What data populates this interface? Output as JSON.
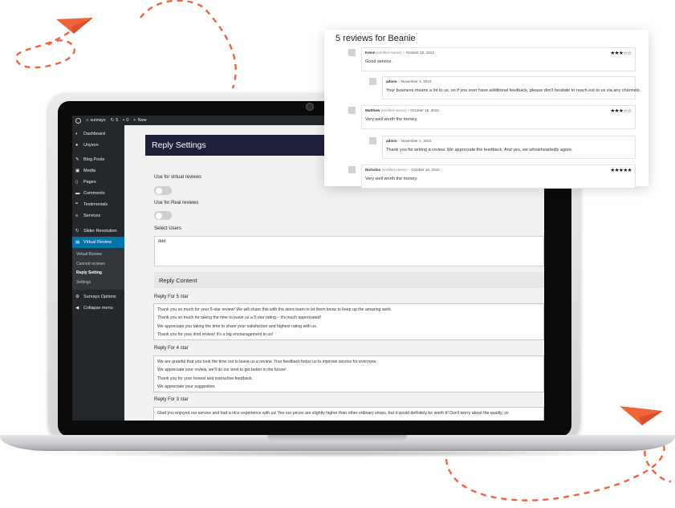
{
  "admin_bar": {
    "site_name": "sunrays",
    "updates_count": "5",
    "comments_count": "0",
    "new_label": "New"
  },
  "sidebar": {
    "items_top": [
      {
        "label": "Dashboard",
        "icon": "dashboard-icon"
      },
      {
        "label": "Unyson",
        "icon": "unyson-icon"
      }
    ],
    "items_mid": [
      {
        "label": "Blog Posts",
        "icon": "pin-icon"
      },
      {
        "label": "Media",
        "icon": "media-icon"
      },
      {
        "label": "Pages",
        "icon": "page-icon"
      },
      {
        "label": "Comments",
        "icon": "comment-icon"
      },
      {
        "label": "Testimonials",
        "icon": "quote-icon"
      },
      {
        "label": "Services",
        "icon": "list-icon"
      }
    ],
    "items_plugin": [
      {
        "label": "Slider Revolution",
        "icon": "refresh-icon"
      },
      {
        "label": "Virtual Review",
        "icon": "review-icon"
      }
    ],
    "submenu": [
      "Virtual Review",
      "Canned reviews",
      "Reply Setting",
      "Settings"
    ],
    "items_bottom": [
      {
        "label": "Sunrays Options",
        "icon": "gear-icon"
      },
      {
        "label": "Collapse menu",
        "icon": "collapse-icon"
      }
    ]
  },
  "settings": {
    "title": "Reply Settings",
    "virtual_label": "Use for virtual reviews",
    "real_label": "Use for Real reviews",
    "users_label": "Select Users",
    "users_value": "ddd",
    "reply_content_heading": "Reply Content",
    "five_star_label": "Reply For 5 star",
    "five_star_lines": [
      "Thank you so much for your 5-star review! We will share this with the store team to let them know to keep up the amazing work.",
      "Thank you so much for taking the time to leave us a 5-star rating – it's much appreciated!",
      "We appreciate you taking the time to share your satisfaction and highest rating with us.",
      "Thank you for your kind review! It's a big encouragement to us!"
    ],
    "four_star_label": "Reply For 4 star",
    "four_star_lines": [
      "We are grateful that you took the time out to leave us a review. Your feedback helps us to improve service for everyone.",
      "We appreciate your review, we'll do our best to get better in the future!",
      "Thank you for your honest and instructive feedback.",
      "We appreciate your suggestion."
    ],
    "three_star_label": "Reply For 3 star",
    "three_star_lines": [
      "Glad you enjoyed our service and had a nice experience with us! Yes our prices are slightly higher than other ordinary shops, but it would definitely be worth it! Don't worry about the quality, yo"
    ]
  },
  "reviews": {
    "title": "5 reviews for Beanie",
    "list": [
      {
        "author": "Kevin",
        "verified": "(verified owner)",
        "date": "– October 12, 2022",
        "text": "Good service.",
        "stars": "★★★☆☆",
        "rating": 3
      },
      {
        "author": "admin",
        "verified": "",
        "date": "– November 4, 2022",
        "text": "Your business means a lot to us, so if you ever have additional feedback, please don't hesitate to reach out to us via any channels.",
        "stars": "",
        "rating": null
      },
      {
        "author": "Matthew",
        "verified": "(verified owner)",
        "date": "– October 16, 2022",
        "text": "Very well worth the money.",
        "stars": "★★★☆☆",
        "rating": 3
      },
      {
        "author": "admin",
        "verified": "",
        "date": "– November 4, 2022",
        "text": "Thank you for writing a review. We appreciate the feedback. And yes, we wholeheartedly agree.",
        "stars": "",
        "rating": null
      },
      {
        "author": "Nicholas",
        "verified": "(verified owner)",
        "date": "– October 19, 2022",
        "text": "Very well worth the money.",
        "stars": "★★★★★",
        "rating": 5
      }
    ]
  },
  "colors": {
    "accent": "#0073aa",
    "header": "#1e1f3b",
    "sidebar": "#23282d",
    "deco": "#f0643c"
  }
}
